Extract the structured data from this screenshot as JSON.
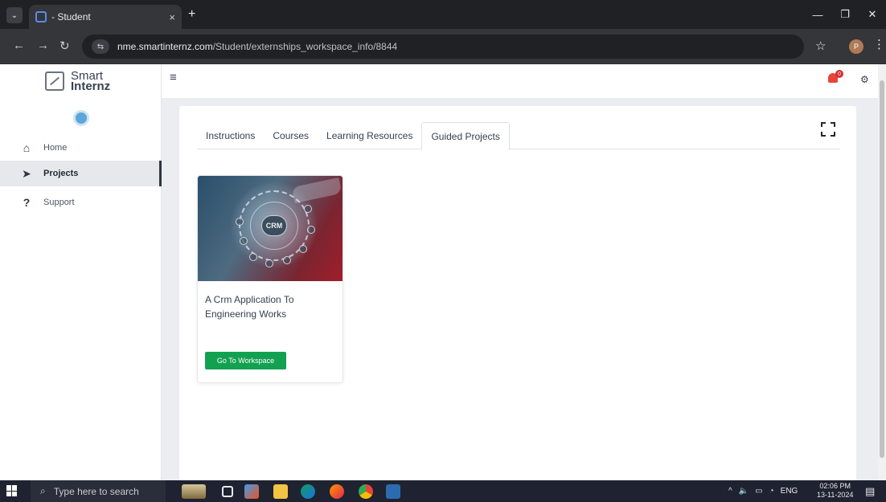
{
  "browser": {
    "tab_title": "- Student",
    "tab_close": "×",
    "new_tab": "+",
    "url_host": "nme.smartinternz.com",
    "url_path": "/Student/externships_workspace_info/8844",
    "profile_initial": "P"
  },
  "sidebar": {
    "logo_line1": "Smart",
    "logo_line2": "Internz",
    "items": [
      {
        "label": "Home",
        "icon": "home-icon",
        "active": false
      },
      {
        "label": "Projects",
        "icon": "paper-plane-icon",
        "active": true
      },
      {
        "label": "Support",
        "icon": "question-icon",
        "active": false
      }
    ]
  },
  "topbar": {
    "notification_count": "0"
  },
  "content": {
    "tabs": [
      {
        "label": "Instructions",
        "active": false
      },
      {
        "label": "Courses",
        "active": false
      },
      {
        "label": "Learning Resources",
        "active": false
      },
      {
        "label": "Guided Projects",
        "active": true
      }
    ],
    "project_card": {
      "thumb_badge": "CRM",
      "title": "A Crm Application To Engineering Works",
      "button_label": "Go To Workspace"
    }
  },
  "taskbar": {
    "search_placeholder": "Type here to search",
    "language": "ENG",
    "time": "02:06 PM",
    "date": "13-11-2024"
  },
  "colors": {
    "accent_green": "#12a150",
    "badge_red": "#d32f2f"
  }
}
